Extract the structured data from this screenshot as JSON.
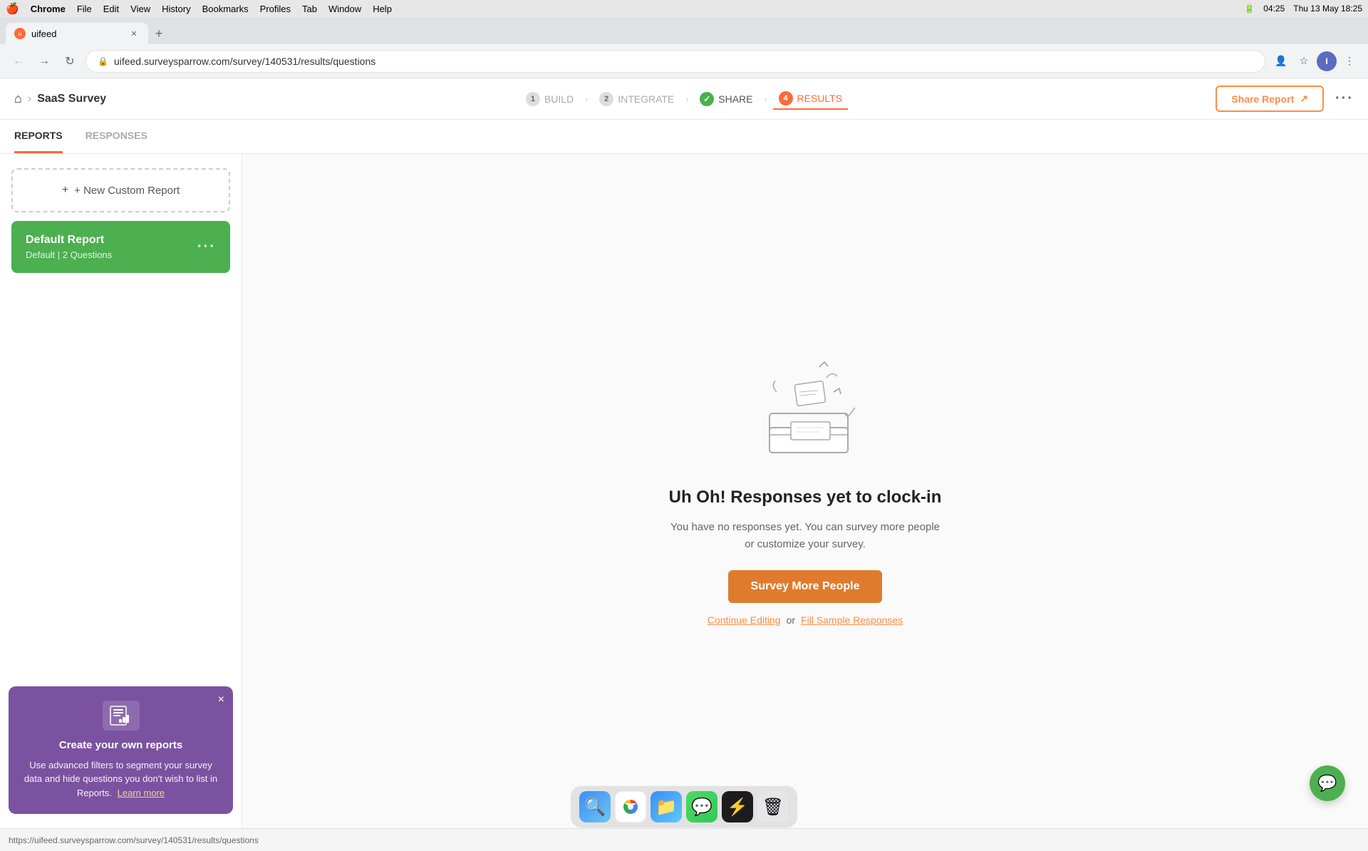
{
  "os": {
    "menubar": {
      "apple": "🍎",
      "chrome": "Chrome",
      "menu_items": [
        "File",
        "Edit",
        "View",
        "History",
        "Bookmarks",
        "Profiles",
        "Tab",
        "Window",
        "Help"
      ],
      "battery_icon": "🔋",
      "time": "04:25",
      "date": "Thu 13 May  18:25"
    },
    "status_bar_url": "https://uifeed.surveysparrow.com/survey/140531/results/questions"
  },
  "browser": {
    "tab_title": "uifeed",
    "address": "uifeed.surveysparrow.com/survey/140531/results/questions",
    "profile": "Incognito"
  },
  "app": {
    "home_icon": "🏠",
    "survey_name": "SaaS Survey",
    "steps": [
      {
        "num": "1",
        "label": "BUILD",
        "state": "default"
      },
      {
        "num": "2",
        "label": "INTEGRATE",
        "state": "default"
      },
      {
        "num": "✓",
        "label": "SHARE",
        "state": "completed"
      },
      {
        "num": "4",
        "label": "RESULTS",
        "state": "active"
      }
    ],
    "share_report_btn": "Share Report",
    "tabs": [
      {
        "label": "REPORTS",
        "active": true
      },
      {
        "label": "RESPONSES",
        "active": false
      }
    ]
  },
  "sidebar": {
    "new_report_label": "+ New Custom Report",
    "report_card": {
      "name": "Default Report",
      "meta": "Default  |  2 Questions"
    },
    "tooltip": {
      "title": "Create your own reports",
      "body": "Use advanced filters to segment your survey data and hide questions you don't wish to list in Reports.",
      "link_text": "Learn more",
      "close": "×"
    }
  },
  "empty_state": {
    "title": "Uh Oh! Responses yet to clock-in",
    "subtitle": "You have no responses yet. You can survey more people or customize your survey.",
    "survey_btn": "Survey More People",
    "continue_link": "Continue Editing",
    "or_text": "or",
    "fill_link": "Fill Sample Responses"
  },
  "chat_widget": {
    "icon": "💬"
  },
  "dock": {
    "icons": [
      "🔍",
      "🌐",
      "📁",
      "💬",
      "⚡",
      "🗑"
    ]
  }
}
